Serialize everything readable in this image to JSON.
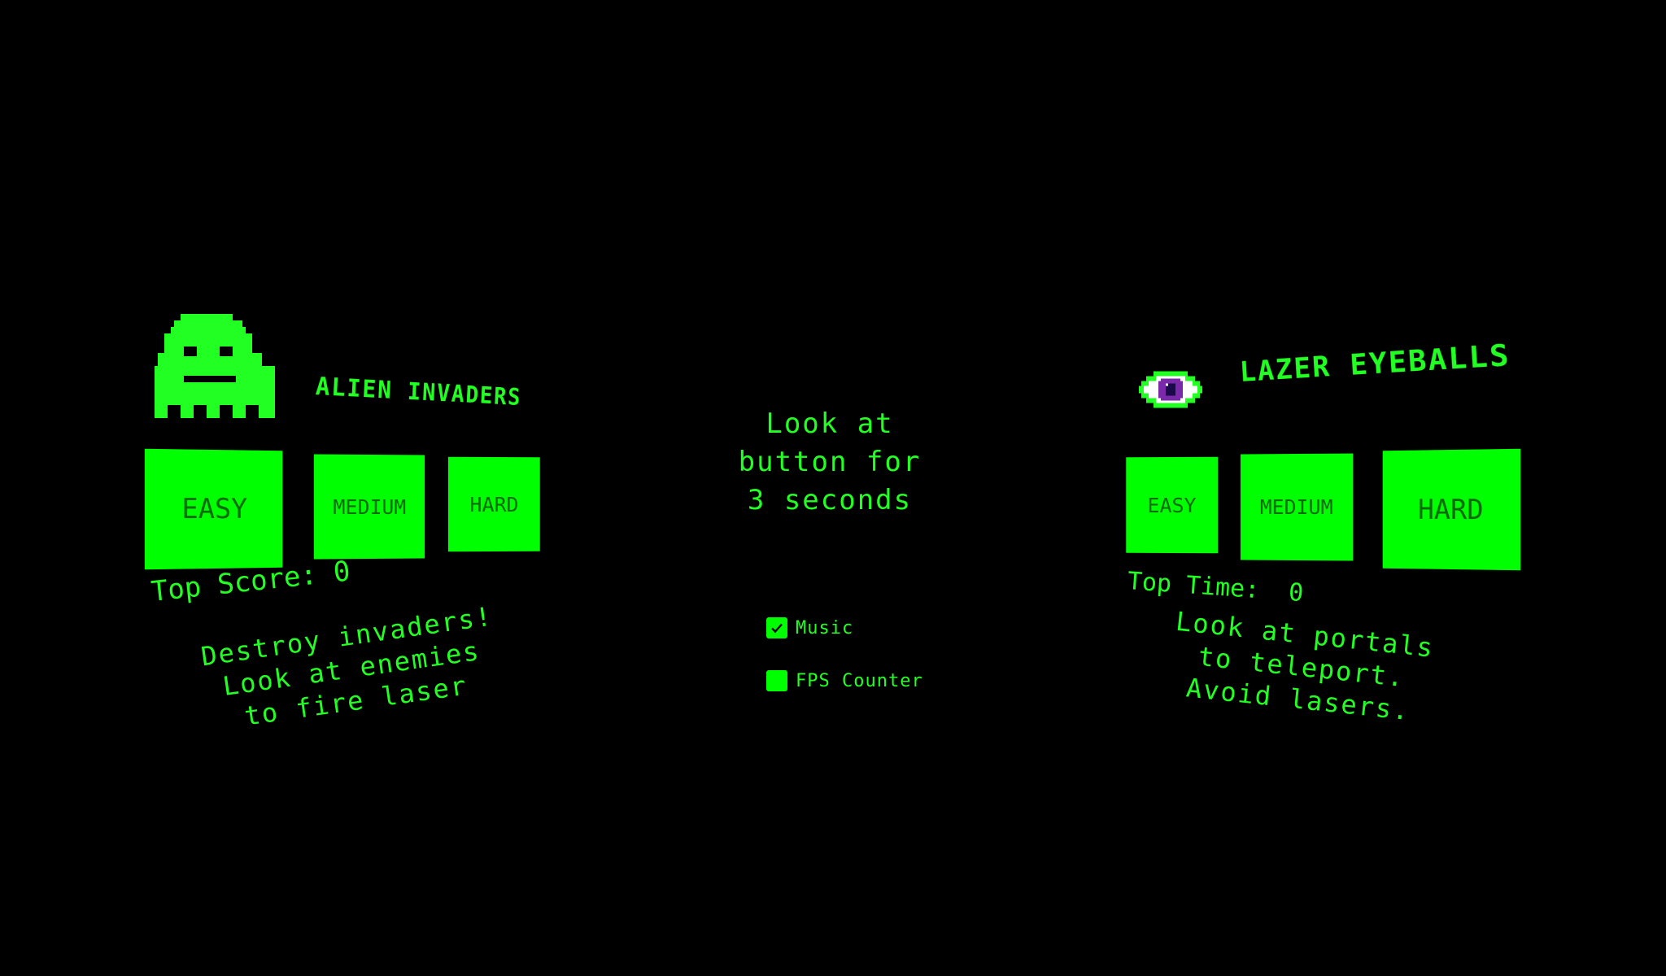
{
  "instruction": {
    "line1": "Look at",
    "line2": "button for",
    "line3": "3 seconds"
  },
  "games": {
    "alien": {
      "title": "ALIEN INVADERS",
      "easy": "EASY",
      "medium": "MEDIUM",
      "hard": "HARD",
      "score_label": "Top Score:",
      "score_value": "0",
      "desc1": "Destroy invaders!",
      "desc2": "Look at enemies",
      "desc3": "to fire laser"
    },
    "lazer": {
      "title": "LAZER EYEBALLS",
      "easy": "EASY",
      "medium": "MEDIUM",
      "hard": "HARD",
      "time_label": "Top Time:",
      "time_value": "0",
      "desc1": "Look at portals",
      "desc2": "to teleport.",
      "desc3": "Avoid lasers."
    }
  },
  "options": {
    "music_label": "Music",
    "music_checked": true,
    "fps_label": "FPS Counter",
    "fps_checked": false
  },
  "colors": {
    "background": "#000000",
    "accent": "#22ff22",
    "button": "#00ff00",
    "button_text": "#0a6a0a",
    "eye_iris": "#7a2aa8"
  },
  "icons": {
    "alien": "alien-invader-icon",
    "eye": "eyeball-icon",
    "check": "checkmark-icon"
  }
}
